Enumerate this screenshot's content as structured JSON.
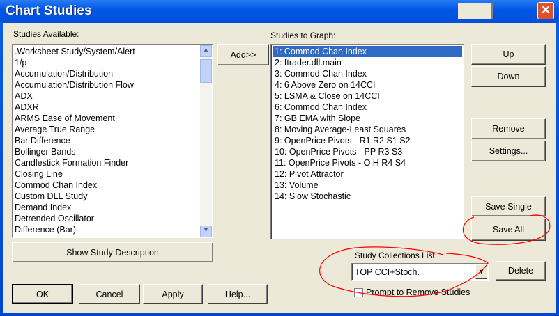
{
  "window": {
    "title": "Chart Studies",
    "close_icon": "close-x-icon"
  },
  "available": {
    "label": "Studies Available:",
    "items": [
      ".Worksheet Study/System/Alert",
      "1/p",
      "Accumulation/Distribution",
      "Accumulation/Distribution Flow",
      "ADX",
      "ADXR",
      "ARMS Ease of Movement",
      "Average True Range",
      "Bar Difference",
      "Bollinger Bands",
      "Candlestick Formation Finder",
      "Closing Line",
      "Commod Chan Index",
      "Custom DLL Study",
      "Demand Index",
      "Detrended Oscillator",
      "Difference (Bar)"
    ]
  },
  "add_label": "Add>>",
  "graph": {
    "label": "Studies to Graph:",
    "selected_index": 0,
    "items": [
      "1: Commod Chan Index",
      "2: ftrader.dll.main",
      "3: Commod Chan Index",
      "4: 6 Above Zero on 14CCI",
      "5: LSMA & Close on 14CCI",
      "6: Commod Chan Index",
      "7: GB EMA with Slope",
      "8: Moving Average-Least Squares",
      "9: OpenPrice Pivots - R1 R2 S1 S2",
      "10: OpenPrice Pivots - PP R3 S3",
      "11: OpenPrice Pivots - O H R4 S4",
      "12: Pivot Attractor",
      "13: Volume",
      "14: Slow Stochastic"
    ]
  },
  "buttons": {
    "up": "Up",
    "down": "Down",
    "remove": "Remove",
    "settings": "Settings...",
    "save_single": "Save Single",
    "save_all": "Save All",
    "show_desc": "Show Study Description",
    "delete": "Delete",
    "ok": "OK",
    "cancel": "Cancel",
    "apply": "Apply",
    "help": "Help..."
  },
  "collections": {
    "label": "Study Collections List:",
    "value": "TOP CCI+Stoch.",
    "prompt_label": "Prompt to Remove Studies",
    "prompt_checked": false
  },
  "annotation_color": "#ff0000"
}
